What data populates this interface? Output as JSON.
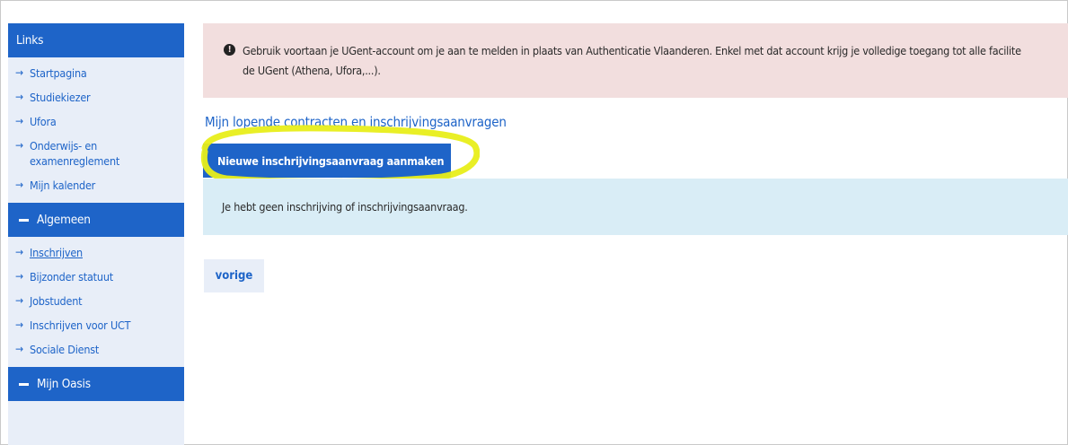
{
  "sidebar": {
    "links_header": "Links",
    "links": [
      {
        "label": "Startpagina"
      },
      {
        "label": "Studiekiezer"
      },
      {
        "label": "Ufora"
      },
      {
        "label": "Onderwijs- en examenreglement"
      },
      {
        "label": "Mijn kalender"
      }
    ],
    "algemeen_header": "Algemeen",
    "algemeen": [
      {
        "label": "Inschrijven"
      },
      {
        "label": "Bijzonder statuut"
      },
      {
        "label": "Jobstudent"
      },
      {
        "label": "Inschrijven voor UCT"
      },
      {
        "label": "Sociale Dienst"
      }
    ],
    "oasis_header": "Mijn Oasis",
    "arrow": "→",
    "item_arrow_glyph": "→"
  },
  "alert": {
    "icon": "exclamation-circle-icon",
    "line1": "Gebruik voortaan je UGent-account om je aan te melden in plaats van Authenticatie Vlaanderen. Enkel met dat account krijg je volledige toegang tot alle facilite",
    "line2": "de UGent (Athena, Ufora,...)."
  },
  "main": {
    "title": "Mijn lopende contracten en inschrijvingsaanvragen",
    "new_button": "Nieuwe inschrijvingsaanvraag aanmaken",
    "info_text": "Je hebt geen inschrijving of inschrijvingsaanvraag.",
    "prev_button": "vorige"
  },
  "colors": {
    "brand_blue": "#1e64c8",
    "sidebar_bg": "#e8eef8",
    "alert_bg": "#f2dede",
    "info_bg": "#d9edf6",
    "highlight": "#e8ee1a"
  }
}
